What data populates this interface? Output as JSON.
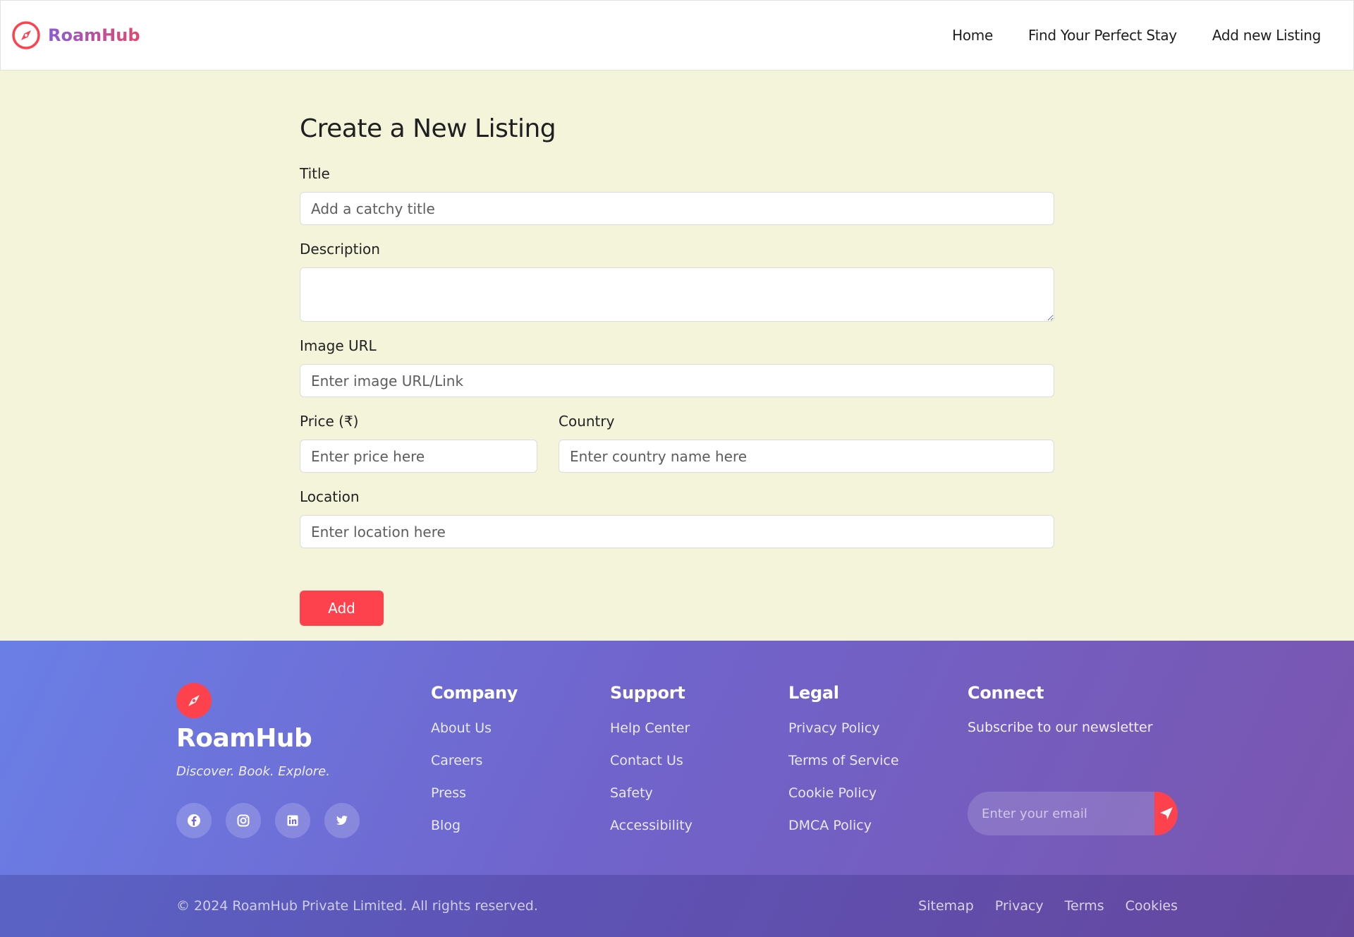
{
  "navbar": {
    "brand": "RoamHub",
    "brand_icon": "compass-icon",
    "links": [
      {
        "label": "Home"
      },
      {
        "label": "Find Your Perfect Stay"
      },
      {
        "label": "Add new Listing"
      }
    ]
  },
  "form": {
    "title": "Create a New Listing",
    "title_field": {
      "label": "Title",
      "placeholder": "Add a catchy title",
      "value": ""
    },
    "description_field": {
      "label": "Description",
      "value": ""
    },
    "image_field": {
      "label": "Image URL",
      "placeholder": "Enter image URL/Link",
      "value": ""
    },
    "price_field": {
      "label": "Price (₹)",
      "placeholder": "Enter price here",
      "value": ""
    },
    "country_field": {
      "label": "Country",
      "placeholder": "Enter country name here",
      "value": ""
    },
    "location_field": {
      "label": "Location",
      "placeholder": "Enter location here",
      "value": ""
    },
    "submit_label": "Add"
  },
  "footer": {
    "brand": "RoamHub",
    "tagline": "Discover. Book. Explore.",
    "socials": [
      "facebook-icon",
      "instagram-icon",
      "linkedin-icon",
      "twitter-icon"
    ],
    "columns": [
      {
        "title": "Company",
        "links": [
          "About Us",
          "Careers",
          "Press",
          "Blog"
        ]
      },
      {
        "title": "Support",
        "links": [
          "Help Center",
          "Contact Us",
          "Safety",
          "Accessibility"
        ]
      },
      {
        "title": "Legal",
        "links": [
          "Privacy Policy",
          "Terms of Service",
          "Cookie Policy",
          "DMCA Policy"
        ]
      }
    ],
    "connect": {
      "title": "Connect",
      "subtitle": "Subscribe to our newsletter",
      "email_placeholder": "Enter your email",
      "submit_icon": "send-icon"
    },
    "copyright": "© 2024 RoamHub Private Limited. All rights reserved.",
    "bottom_links": [
      "Sitemap",
      "Privacy",
      "Terms",
      "Cookies"
    ]
  },
  "colors": {
    "accent": "#fe424d",
    "page_background": "#f4f4db",
    "footer_gradient_start": "#6a7fe6",
    "footer_gradient_end": "#7a55ae"
  }
}
